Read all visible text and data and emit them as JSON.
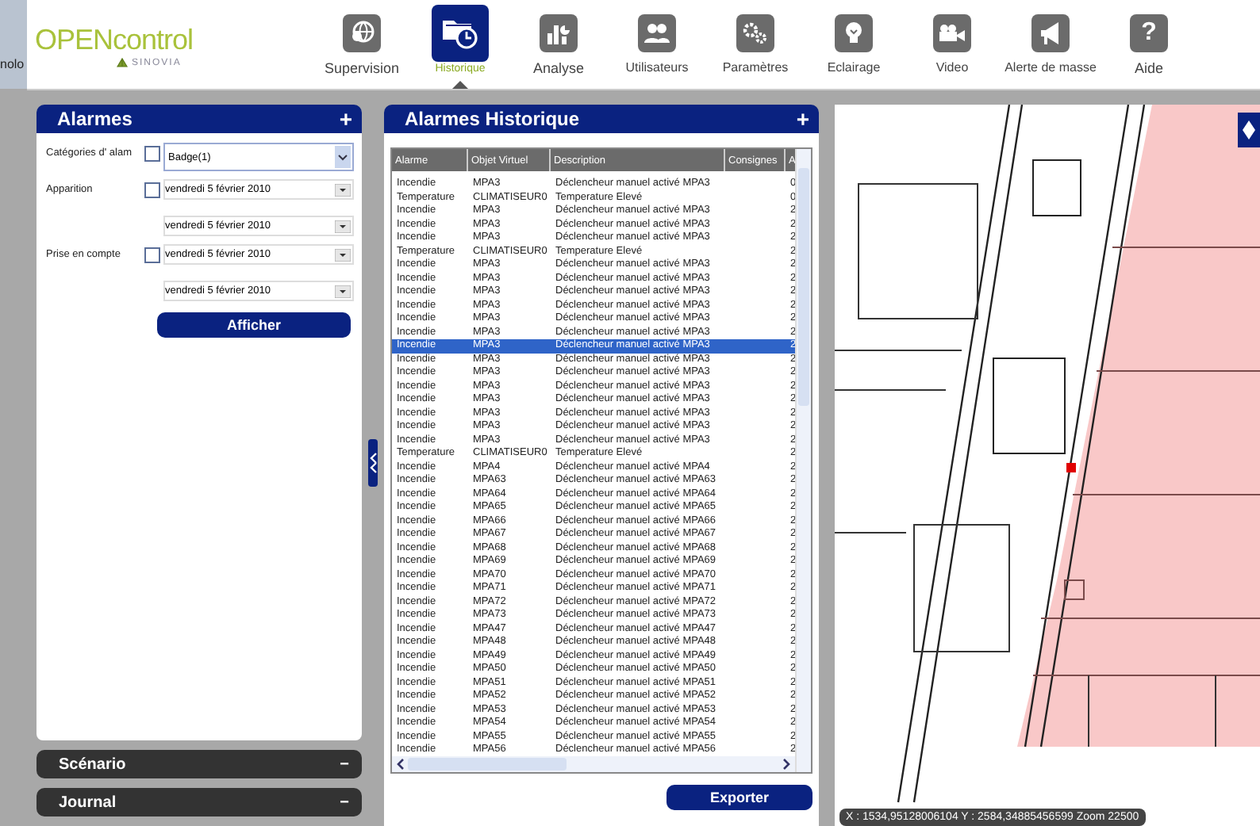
{
  "background_window": {
    "text": "nolo"
  },
  "logo": {
    "name": "OPENcontrol",
    "brand": "SINOVIA"
  },
  "nav": [
    {
      "label": "Supervision",
      "selected": false
    },
    {
      "label": "Historique",
      "selected": true
    },
    {
      "label": "Analyse",
      "selected": false
    },
    {
      "label": "Utilisateurs",
      "selected": false
    },
    {
      "label": "Paramètres",
      "selected": false
    },
    {
      "label": "Eclairage",
      "selected": false
    },
    {
      "label": "Video",
      "selected": false
    },
    {
      "label": "Alerte de masse",
      "selected": false
    },
    {
      "label": "Aide",
      "glyph": "?",
      "selected": false
    }
  ],
  "alarm_panel": {
    "title": "Alarmes",
    "add": "+",
    "filters": [
      {
        "label": "Catégories d' alam",
        "checked": false,
        "kind": "combo",
        "values": [
          "Badge(1)"
        ]
      },
      {
        "label": "Apparition",
        "checked": false,
        "kind": "dates",
        "values": [
          "vendredi 5 février 2010",
          "vendredi 5 février 2010"
        ]
      },
      {
        "label": "Prise en compte",
        "checked": false,
        "kind": "dates",
        "values": [
          "vendredi 5 février 2010",
          "vendredi 5 février 2010"
        ]
      }
    ],
    "button": "Afficher"
  },
  "collapsed_panels": [
    {
      "title": "Scénario",
      "toggle": "−"
    },
    {
      "title": "Journal",
      "toggle": "−"
    }
  ],
  "history_panel": {
    "title": "Alarmes Historique",
    "add": "+",
    "button": "Exporter",
    "table": {
      "columns": [
        "Alarme",
        "Objet Virtuel",
        "Description",
        "Consignes",
        "A"
      ],
      "rows": [
        {
          "cells": [
            "Incendie",
            "MPA3",
            "Déclencheur manuel activé MPA3",
            "",
            "0"
          ],
          "selected": false
        },
        {
          "cells": [
            "Temperature",
            "CLIMATISEUR0",
            "Temperature Elevé",
            "",
            "0"
          ],
          "selected": false
        },
        {
          "cells": [
            "Incendie",
            "MPA3",
            "Déclencheur manuel activé MPA3",
            "",
            "2"
          ],
          "selected": false
        },
        {
          "cells": [
            "Incendie",
            "MPA3",
            "Déclencheur manuel activé MPA3",
            "",
            "2"
          ],
          "selected": false
        },
        {
          "cells": [
            "Incendie",
            "MPA3",
            "Déclencheur manuel activé MPA3",
            "",
            "2"
          ],
          "selected": false
        },
        {
          "cells": [
            "Temperature",
            "CLIMATISEUR0",
            "Temperature Elevé",
            "",
            "2"
          ],
          "selected": false
        },
        {
          "cells": [
            "Incendie",
            "MPA3",
            "Déclencheur manuel activé MPA3",
            "",
            "2"
          ],
          "selected": false
        },
        {
          "cells": [
            "Incendie",
            "MPA3",
            "Déclencheur manuel activé MPA3",
            "",
            "2"
          ],
          "selected": false
        },
        {
          "cells": [
            "Incendie",
            "MPA3",
            "Déclencheur manuel activé MPA3",
            "",
            "2"
          ],
          "selected": false
        },
        {
          "cells": [
            "Incendie",
            "MPA3",
            "Déclencheur manuel activé MPA3",
            "",
            "2"
          ],
          "selected": false
        },
        {
          "cells": [
            "Incendie",
            "MPA3",
            "Déclencheur manuel activé MPA3",
            "",
            "2"
          ],
          "selected": false
        },
        {
          "cells": [
            "Incendie",
            "MPA3",
            "Déclencheur manuel activé MPA3",
            "",
            "2"
          ],
          "selected": false
        },
        {
          "cells": [
            "Incendie",
            "MPA3",
            "Déclencheur manuel activé MPA3",
            "",
            "2"
          ],
          "selected": true
        },
        {
          "cells": [
            "Incendie",
            "MPA3",
            "Déclencheur manuel activé MPA3",
            "",
            "2"
          ],
          "selected": false
        },
        {
          "cells": [
            "Incendie",
            "MPA3",
            "Déclencheur manuel activé MPA3",
            "",
            "2"
          ],
          "selected": false
        },
        {
          "cells": [
            "Incendie",
            "MPA3",
            "Déclencheur manuel activé MPA3",
            "",
            "2"
          ],
          "selected": false
        },
        {
          "cells": [
            "Incendie",
            "MPA3",
            "Déclencheur manuel activé MPA3",
            "",
            "2"
          ],
          "selected": false
        },
        {
          "cells": [
            "Incendie",
            "MPA3",
            "Déclencheur manuel activé MPA3",
            "",
            "2"
          ],
          "selected": false
        },
        {
          "cells": [
            "Incendie",
            "MPA3",
            "Déclencheur manuel activé MPA3",
            "",
            "2"
          ],
          "selected": false
        },
        {
          "cells": [
            "Incendie",
            "MPA3",
            "Déclencheur manuel activé MPA3",
            "",
            "2"
          ],
          "selected": false
        },
        {
          "cells": [
            "Temperature",
            "CLIMATISEUR0",
            "Temperature Elevé",
            "",
            "2"
          ],
          "selected": false
        },
        {
          "cells": [
            "Incendie",
            "MPA4",
            "Déclencheur manuel activé MPA4",
            "",
            "2"
          ],
          "selected": false
        },
        {
          "cells": [
            "Incendie",
            "MPA63",
            "Déclencheur manuel activé MPA63",
            "",
            "2"
          ],
          "selected": false
        },
        {
          "cells": [
            "Incendie",
            "MPA64",
            "Déclencheur manuel activé MPA64",
            "",
            "2"
          ],
          "selected": false
        },
        {
          "cells": [
            "Incendie",
            "MPA65",
            "Déclencheur manuel activé MPA65",
            "",
            "2"
          ],
          "selected": false
        },
        {
          "cells": [
            "Incendie",
            "MPA66",
            "Déclencheur manuel activé MPA66",
            "",
            "2"
          ],
          "selected": false
        },
        {
          "cells": [
            "Incendie",
            "MPA67",
            "Déclencheur manuel activé MPA67",
            "",
            "2"
          ],
          "selected": false
        },
        {
          "cells": [
            "Incendie",
            "MPA68",
            "Déclencheur manuel activé MPA68",
            "",
            "2"
          ],
          "selected": false
        },
        {
          "cells": [
            "Incendie",
            "MPA69",
            "Déclencheur manuel activé MPA69",
            "",
            "2"
          ],
          "selected": false
        },
        {
          "cells": [
            "Incendie",
            "MPA70",
            "Déclencheur manuel activé MPA70",
            "",
            "2"
          ],
          "selected": false
        },
        {
          "cells": [
            "Incendie",
            "MPA71",
            "Déclencheur manuel activé MPA71",
            "",
            "2"
          ],
          "selected": false
        },
        {
          "cells": [
            "Incendie",
            "MPA72",
            "Déclencheur manuel activé MPA72",
            "",
            "2"
          ],
          "selected": false
        },
        {
          "cells": [
            "Incendie",
            "MPA73",
            "Déclencheur manuel activé MPA73",
            "",
            "2"
          ],
          "selected": false
        },
        {
          "cells": [
            "Incendie",
            "MPA47",
            "Déclencheur manuel activé MPA47",
            "",
            "2"
          ],
          "selected": false
        },
        {
          "cells": [
            "Incendie",
            "MPA48",
            "Déclencheur manuel activé MPA48",
            "",
            "2"
          ],
          "selected": false
        },
        {
          "cells": [
            "Incendie",
            "MPA49",
            "Déclencheur manuel activé MPA49",
            "",
            "2"
          ],
          "selected": false
        },
        {
          "cells": [
            "Incendie",
            "MPA50",
            "Déclencheur manuel activé MPA50",
            "",
            "2"
          ],
          "selected": false
        },
        {
          "cells": [
            "Incendie",
            "MPA51",
            "Déclencheur manuel activé MPA51",
            "",
            "2"
          ],
          "selected": false
        },
        {
          "cells": [
            "Incendie",
            "MPA52",
            "Déclencheur manuel activé MPA52",
            "",
            "2"
          ],
          "selected": false
        },
        {
          "cells": [
            "Incendie",
            "MPA53",
            "Déclencheur manuel activé MPA53",
            "",
            "2"
          ],
          "selected": false
        },
        {
          "cells": [
            "Incendie",
            "MPA54",
            "Déclencheur manuel activé MPA54",
            "",
            "2"
          ],
          "selected": false
        },
        {
          "cells": [
            "Incendie",
            "MPA55",
            "Déclencheur manuel activé MPA55",
            "",
            "2"
          ],
          "selected": false
        },
        {
          "cells": [
            "Incendie",
            "MPA56",
            "Déclencheur manuel activé MPA56",
            "",
            "2"
          ],
          "selected": false
        }
      ]
    }
  },
  "map": {
    "kind": "picture",
    "coordinates": "X : 1534,95128006104 Y : 2584,34885456599 Zoom 22500"
  }
}
